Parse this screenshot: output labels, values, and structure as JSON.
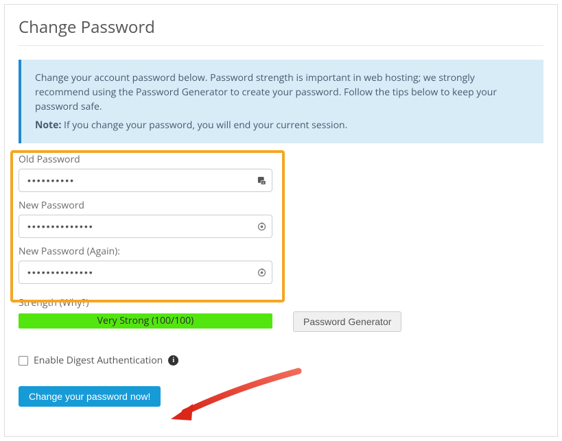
{
  "page": {
    "title": "Change Password"
  },
  "alert": {
    "body": "Change your account password below. Password strength is important in web hosting; we strongly recommend using the Password Generator to create your password. Follow the tips below to keep your password safe.",
    "note_label": "Note:",
    "note_body": "If you change your password, you will end your current session."
  },
  "form": {
    "old_password_label": "Old Password",
    "old_password_value": "••••••••••",
    "new_password_label": "New Password",
    "new_password_value": "••••••••••••••",
    "new_password_again_label": "New Password (Again):",
    "new_password_again_value": "••••••••••••••",
    "strength_label": "Strength (Why?)",
    "strength_text": "Very Strong (100/100)",
    "strength_color": "#53e510",
    "generator_button": "Password Generator",
    "digest_checkbox_label": "Enable Digest Authentication",
    "submit_button": "Change your password now!"
  },
  "annotations": {
    "highlight_color": "#f5a623",
    "arrow_color": "#e63b2e"
  }
}
